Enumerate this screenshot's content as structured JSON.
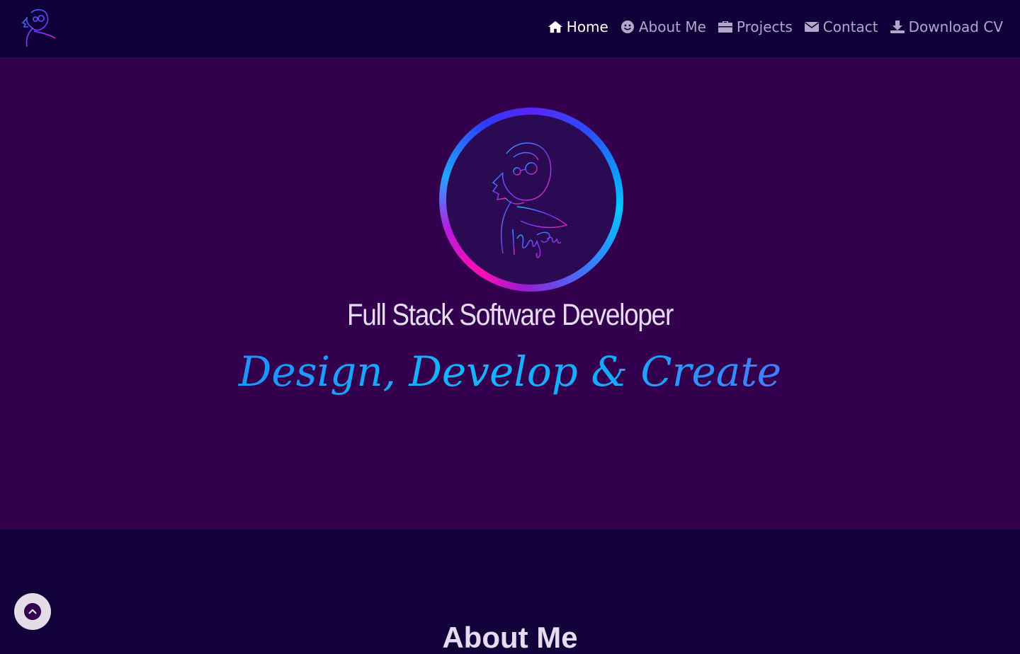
{
  "nav": {
    "links": [
      {
        "label": "Home",
        "icon": "home-icon",
        "active": true
      },
      {
        "label": "About Me",
        "icon": "smile-icon",
        "active": false
      },
      {
        "label": "Projects",
        "icon": "briefcase-icon",
        "active": false
      },
      {
        "label": "Contact",
        "icon": "envelope-icon",
        "active": false
      },
      {
        "label": "Download CV",
        "icon": "download-icon",
        "active": false
      }
    ]
  },
  "hero": {
    "title": "Full Stack Software Developer",
    "tagline": "Design, Develop & Create"
  },
  "next_section": {
    "heading": "About Me"
  },
  "colors": {
    "nav_bg": "#10003a",
    "hero_bg": "#32004d",
    "page_bg": "#12003b",
    "accent_blue": "#15b5ff",
    "accent_pink": "#ff0fb0"
  }
}
